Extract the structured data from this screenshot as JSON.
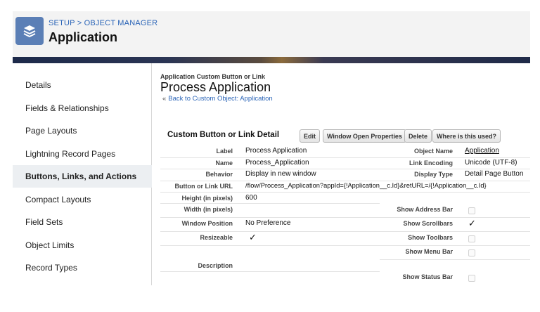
{
  "header": {
    "breadcrumb_setup": "SETUP",
    "breadcrumb_sep": ">",
    "breadcrumb_object_manager": "OBJECT MANAGER",
    "title": "Application",
    "icon": "layers-icon"
  },
  "sidebar": {
    "items": [
      {
        "label": "Details"
      },
      {
        "label": "Fields & Relationships"
      },
      {
        "label": "Page Layouts"
      },
      {
        "label": "Lightning Record Pages"
      },
      {
        "label": "Buttons, Links, and Actions"
      },
      {
        "label": "Compact Layouts"
      },
      {
        "label": "Field Sets"
      },
      {
        "label": "Object Limits"
      },
      {
        "label": "Record Types"
      }
    ],
    "active": "Buttons, Links, and Actions"
  },
  "main": {
    "sub_label": "Application Custom Button or Link",
    "title": "Process Application",
    "back_marker": "«",
    "back_link": "Back to Custom Object: Application",
    "detail_header": "Custom Button or Link Detail",
    "buttons": {
      "edit": "Edit",
      "window_open_properties": "Window Open Properties",
      "delete": "Delete",
      "where_used": "Where is this used?"
    },
    "fields": {
      "label_label": "Label",
      "label_value": "Process Application",
      "name_label": "Name",
      "name_value": "Process_Application",
      "behavior_label": "Behavior",
      "behavior_value": "Display in new window",
      "url_label": "Button or Link URL",
      "url_value": "/flow/Process_Application?appId={!Application__c.Id}&retURL=/{!Application__c.Id}",
      "height_label": "Height (in pixels)",
      "height_value": "600",
      "width_label": "Width (in pixels)",
      "width_value": "",
      "window_position_label": "Window Position",
      "window_position_value": "No Preference",
      "resizeable_label": "Resizeable",
      "resizeable_value": true,
      "description_label": "Description",
      "description_value": "",
      "object_name_label": "Object Name",
      "object_name_value": "Application",
      "link_encoding_label": "Link Encoding",
      "link_encoding_value": "Unicode (UTF-8)",
      "display_type_label": "Display Type",
      "display_type_value": "Detail Page Button",
      "show_address_bar_label": "Show Address Bar",
      "show_address_bar_value": false,
      "show_scrollbars_label": "Show Scrollbars",
      "show_scrollbars_value": true,
      "show_toolbars_label": "Show Toolbars",
      "show_toolbars_value": false,
      "show_menu_bar_label": "Show Menu Bar",
      "show_menu_bar_value": false,
      "show_status_bar_label": "Show Status Bar",
      "show_status_bar_value": false
    },
    "check_glyph": "✓"
  },
  "colors": {
    "link": "#2a64b7",
    "header_bg": "#f3f3f3",
    "icon_bg": "#5b7fb6",
    "active_item_bg": "#eceff2"
  }
}
